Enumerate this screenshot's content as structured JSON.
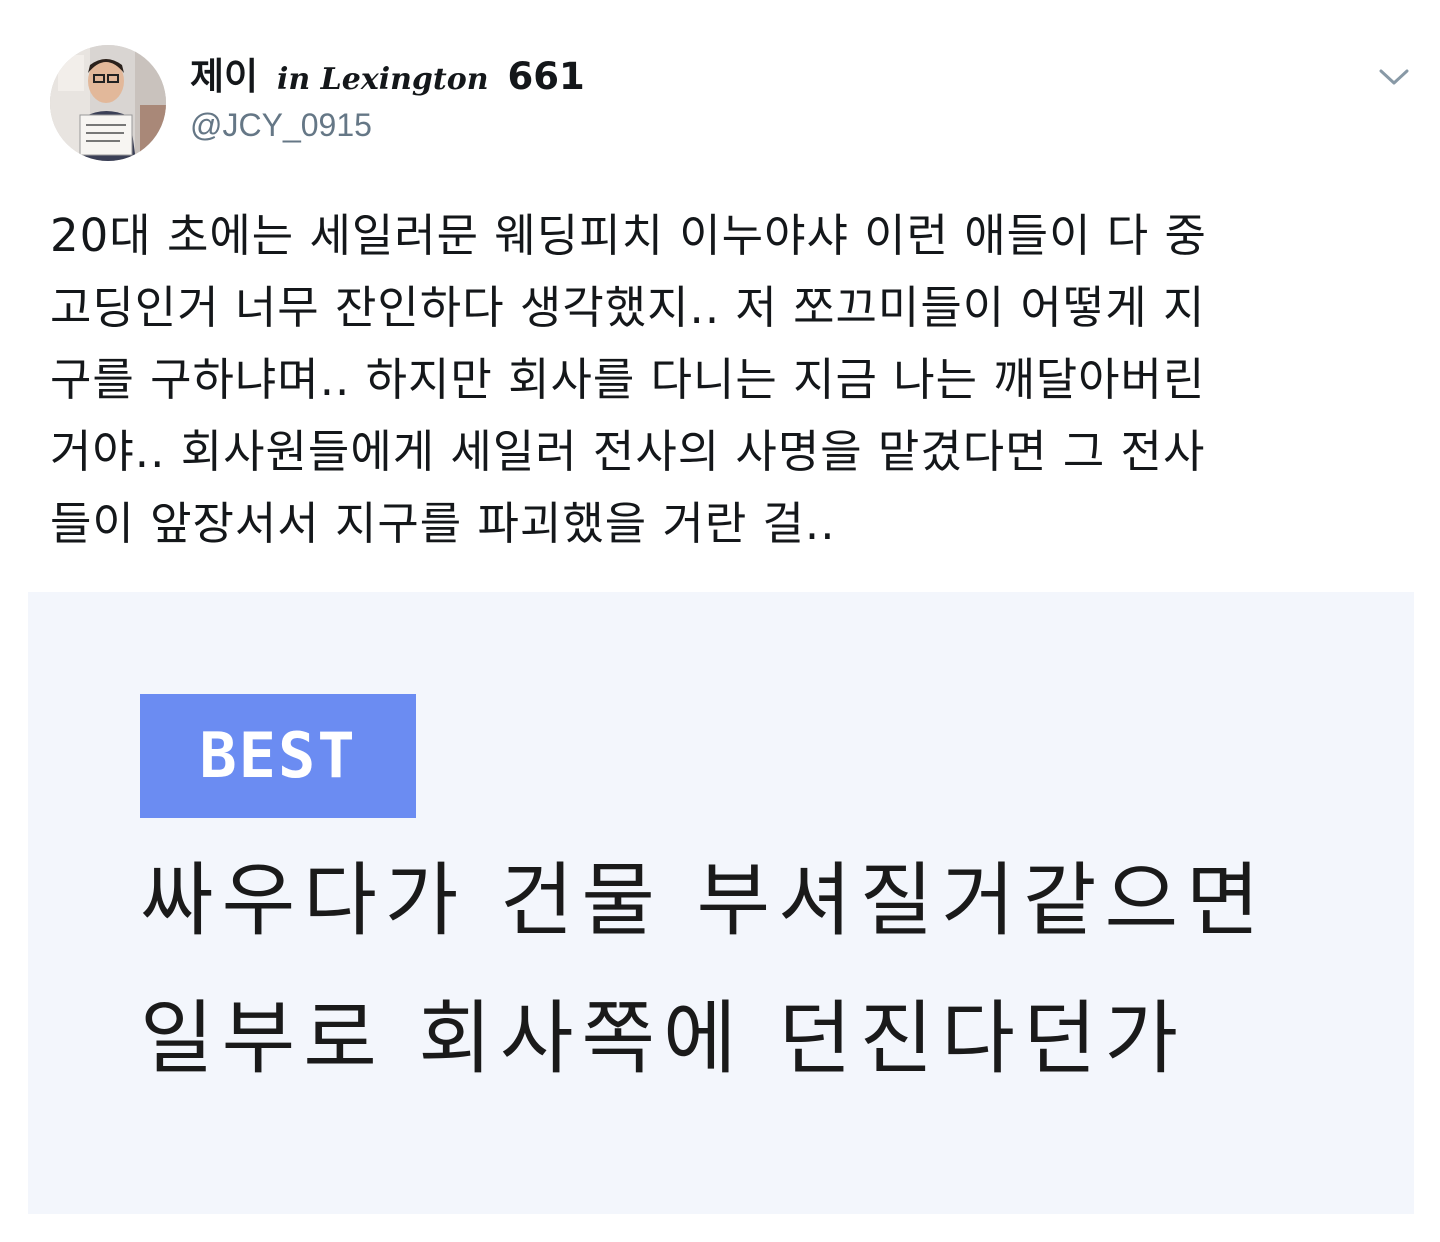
{
  "tweet": {
    "author": {
      "name_prefix": "제이",
      "name_script": "in Lexington",
      "name_suffix": "661",
      "handle": "@JCY_0915"
    },
    "text_lines": [
      "20대 초에는 세일러문 웨딩피치 이누야샤 이런 애들이 다 중",
      "고딩인거 너무 잔인하다 생각했지.. 저 쪼끄미들이 어떻게 지",
      "구를 구하냐며.. 하지만 회사를 다니는 지금 나는 깨달아버린",
      "거야.. 회사원들에게 세일러 전사의 사명을 맡겼다면 그 전사",
      "들이 앞장서서 지구를 파괴했을 거란 걸.."
    ],
    "icons": {
      "menu": "chevron-down-icon"
    },
    "media": {
      "badge": "BEST",
      "comment_lines": [
        "싸우다가 건물 부셔질거같으면",
        "일부로 회사쪽에 던진다던가"
      ],
      "badge_color": "#6b8cf2",
      "background_color": "#f3f6fc"
    }
  }
}
